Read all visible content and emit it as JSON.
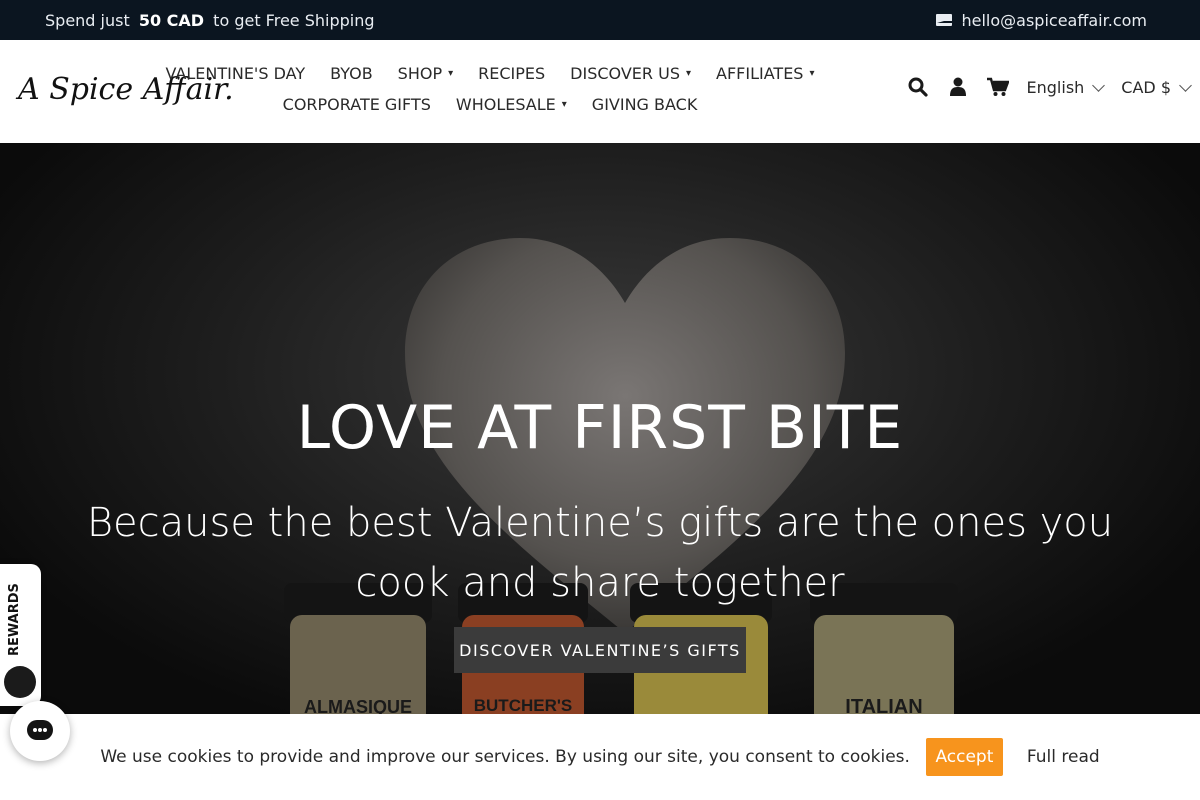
{
  "topbar": {
    "promo_prefix": "Spend just",
    "promo_amount": "50 CAD",
    "promo_suffix": "to get Free Shipping",
    "email": "hello@aspiceaffair.com",
    "email_icon": "envelope-icon"
  },
  "header": {
    "logo_text": "A Spice Affair.",
    "nav_row1": [
      {
        "label": "VALENTINE'S DAY",
        "dropdown": false
      },
      {
        "label": "BYOB",
        "dropdown": false
      },
      {
        "label": "SHOP",
        "dropdown": true
      },
      {
        "label": "RECIPES",
        "dropdown": false
      },
      {
        "label": "DISCOVER US",
        "dropdown": true
      },
      {
        "label": "AFFILIATES",
        "dropdown": true
      }
    ],
    "nav_row2": [
      {
        "label": "CORPORATE GIFTS",
        "dropdown": false
      },
      {
        "label": "WHOLESALE",
        "dropdown": true
      },
      {
        "label": "GIVING BACK",
        "dropdown": false
      }
    ],
    "caret": "▾",
    "icons": [
      "search-icon",
      "user-icon",
      "cart-icon"
    ],
    "language": "English",
    "currency": "CAD $"
  },
  "hero": {
    "title": "LOVE AT FIRST BITE",
    "subtitle": "Because the best Valentine’s gifts are the ones you cook and share together",
    "cta": "DISCOVER VALENTINE’S GIFTS",
    "jar_labels": [
      "ALMASIQUE",
      "BUTCHER'S",
      "",
      "ITALIAN"
    ]
  },
  "rewards": {
    "label": "REWARDS"
  },
  "cookie": {
    "message": "We use cookies to provide and improve our services. By using our site, you consent to cookies.",
    "accept": "Accept",
    "full_read": "Full read",
    "accent": "#f7941d"
  }
}
